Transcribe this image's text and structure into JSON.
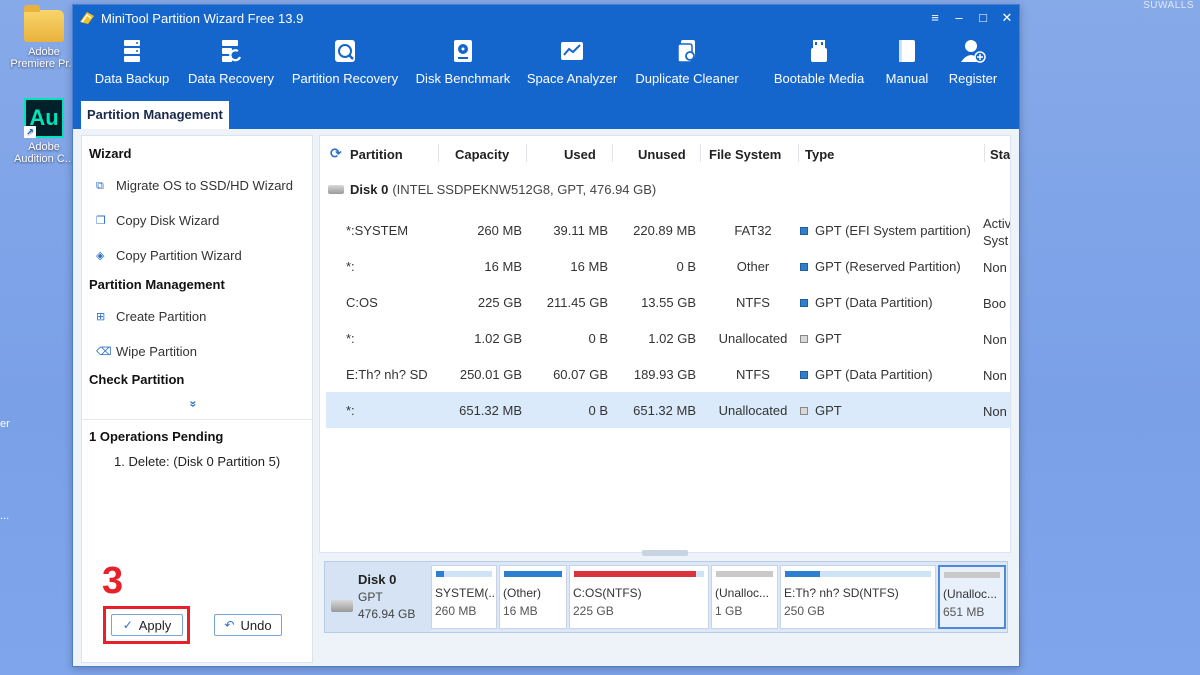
{
  "desktop": {
    "icons": [
      {
        "label": "Adobe Premiere Pr..."
      },
      {
        "label": "Adobe Audition C..."
      }
    ],
    "edge_labels": [
      "er",
      "..."
    ],
    "watermark": "SUWALLS"
  },
  "window": {
    "title": "MiniTool Partition Wizard Free 13.9",
    "controls": [
      "≡",
      "–",
      "□",
      "✕"
    ]
  },
  "toolbar": {
    "items": [
      {
        "label": "Data Backup",
        "icon": "data-backup-icon"
      },
      {
        "label": "Data Recovery",
        "icon": "data-recovery-icon"
      },
      {
        "label": "Partition Recovery",
        "icon": "partition-recovery-icon"
      },
      {
        "label": "Disk Benchmark",
        "icon": "disk-benchmark-icon"
      },
      {
        "label": "Space Analyzer",
        "icon": "space-analyzer-icon"
      },
      {
        "label": "Duplicate Cleaner",
        "icon": "duplicate-cleaner-icon"
      },
      {
        "label": "Bootable Media",
        "icon": "bootable-media-icon"
      },
      {
        "label": "Manual",
        "icon": "manual-icon"
      },
      {
        "label": "Register",
        "icon": "register-icon"
      }
    ]
  },
  "tab": {
    "label": "Partition Management"
  },
  "sidebar": {
    "wizard_title": "Wizard",
    "wizard_items": [
      "Migrate OS to SSD/HD Wizard",
      "Copy Disk Wizard",
      "Copy Partition Wizard"
    ],
    "pm_title": "Partition Management",
    "pm_items": [
      "Create Partition",
      "Wipe Partition"
    ],
    "check_title": "Check Partition",
    "more": "»"
  },
  "pending": {
    "title": "1 Operations Pending",
    "items": [
      "1. Delete: (Disk 0 Partition 5)"
    ]
  },
  "step_number": "3",
  "buttons": {
    "apply": "Apply",
    "undo": "Undo"
  },
  "table": {
    "columns": [
      "Partition",
      "Capacity",
      "Used",
      "Unused",
      "File System",
      "Type",
      "Sta"
    ],
    "disk": {
      "name": "Disk 0",
      "info": "(INTEL SSDPEKNW512G8, GPT, 476.94 GB)"
    },
    "rows": [
      {
        "partition": "*:SYSTEM",
        "capacity": "260 MB",
        "used": "39.11 MB",
        "unused": "220.89 MB",
        "fs": "FAT32",
        "type": "GPT (EFI System partition)",
        "type_color": "blue",
        "status1": "Activ",
        "status2": "Syst"
      },
      {
        "partition": "*:",
        "capacity": "16 MB",
        "used": "16 MB",
        "unused": "0 B",
        "fs": "Other",
        "type": "GPT (Reserved Partition)",
        "type_color": "blue",
        "status1": "Non",
        "status2": ""
      },
      {
        "partition": "C:OS",
        "capacity": "225 GB",
        "used": "211.45 GB",
        "unused": "13.55 GB",
        "fs": "NTFS",
        "type": "GPT (Data Partition)",
        "type_color": "blue",
        "status1": "Boo",
        "status2": ""
      },
      {
        "partition": "*:",
        "capacity": "1.02 GB",
        "used": "0 B",
        "unused": "1.02 GB",
        "fs": "Unallocated",
        "type": "GPT",
        "type_color": "gray",
        "status1": "Non",
        "status2": ""
      },
      {
        "partition": "E:Th? nh? SD",
        "capacity": "250.01 GB",
        "used": "60.07 GB",
        "unused": "189.93 GB",
        "fs": "NTFS",
        "type": "GPT (Data Partition)",
        "type_color": "blue",
        "status1": "Non",
        "status2": ""
      },
      {
        "partition": "*:",
        "capacity": "651.32 MB",
        "used": "0 B",
        "unused": "651.32 MB",
        "fs": "Unallocated",
        "type": "GPT",
        "type_color": "gray",
        "status1": "Non",
        "status2": "",
        "selected": true
      }
    ]
  },
  "diskmap": {
    "disk": {
      "name": "Disk 0",
      "type": "GPT",
      "size": "476.94 GB"
    },
    "parts": [
      {
        "l1": "SYSTEM(...",
        "l2": "260 MB",
        "fill": 0.15,
        "color": "#2f7fd0"
      },
      {
        "l1": "(Other)",
        "l2": "16 MB",
        "fill": 1.0,
        "color": "#2f7fd0"
      },
      {
        "l1": "C:OS(NTFS)",
        "l2": "225 GB",
        "fill": 0.94,
        "color": "#d9343d"
      },
      {
        "l1": "(Unalloc...",
        "l2": "1 GB",
        "fill": 1.0,
        "color": "#c9c9c9"
      },
      {
        "l1": "E:Th? nh? SD(NTFS)",
        "l2": "250 GB",
        "fill": 0.24,
        "color": "#2f7fd0"
      },
      {
        "l1": "(Unalloc...",
        "l2": "651 MB",
        "fill": 1.0,
        "color": "#c9c9c9",
        "selected": true
      }
    ]
  },
  "colors": {
    "titlebar": "#1566cc",
    "selected_row": "#daeafa",
    "highlight": "#e8202a"
  }
}
